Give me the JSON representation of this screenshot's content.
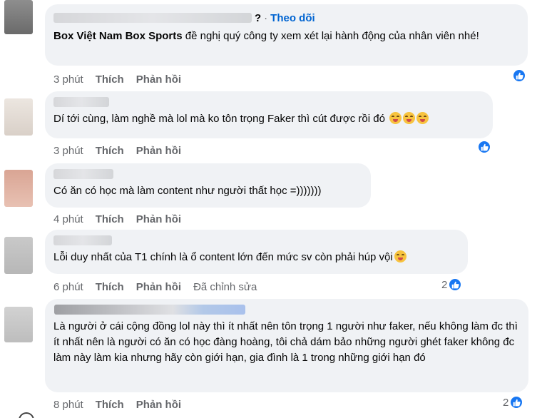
{
  "comments": [
    {
      "author": "Box Việt Nam Box Sports",
      "header_suffix": "?",
      "follow_label": "Theo dõi",
      "separator": "·",
      "text": " đề nghị quý công ty xem xét lại hành động của nhân viên nhé!",
      "time": "3 phút",
      "like_label": "Thích",
      "reply_label": "Phản hồi",
      "reaction_icon": "like-icon"
    },
    {
      "text": "Dí tới cùng, làm nghề mà lol mà ko tôn trọng Faker thì cút được rồi đó",
      "emoji": "laughing-face-emoji",
      "time": "3 phút",
      "like_label": "Thích",
      "reply_label": "Phản hồi",
      "reaction_icon": "like-icon"
    },
    {
      "text": "Có ăn có học mà làm content như người thất học =)))))))",
      "time": "4 phút",
      "like_label": "Thích",
      "reply_label": "Phản hồi"
    },
    {
      "text": "Lỗi duy nhất của T1 chính là ổ content lớn đến mức sv còn phải húp vội",
      "emoji": "laughing-face-emoji",
      "time": "6 phút",
      "like_label": "Thích",
      "reply_label": "Phản hồi",
      "edited_label": "Đã chỉnh sửa",
      "reaction_count": "2",
      "reaction_icon": "like-icon"
    },
    {
      "text": "Là người ở cái cộng đồng lol này thì ít nhất nên tôn trọng 1 người như faker, nếu không làm đc thì ít nhất nên là người có ăn có học đàng hoàng, tôi chả dám bảo những người ghét faker không đc làm này làm kia nhưng hãy còn giới hạn, gia đình là 1 trong những giới hạn đó",
      "time": "8 phút",
      "like_label": "Thích",
      "reply_label": "Phản hồi",
      "reaction_count": "2",
      "reaction_icon": "like-icon"
    }
  ],
  "colors": {
    "bubble_bg": "#f0f2f5",
    "meta_text": "#65676b",
    "follow_link": "#0064d1",
    "like_blue": "#1877f2"
  }
}
